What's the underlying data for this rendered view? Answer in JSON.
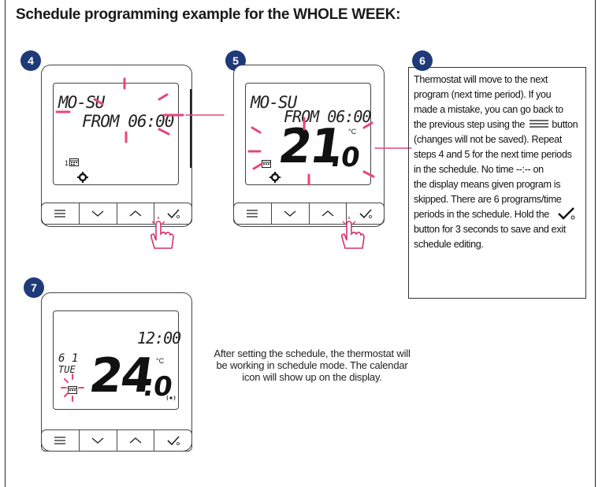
{
  "title": "Schedule programming example for the WHOLE WEEK:",
  "steps": [
    {
      "number": "4",
      "lcd_days": "MO-SU",
      "lcd_from": "FROM 06:00"
    },
    {
      "number": "5",
      "lcd_days": "MO-SU",
      "lcd_from": "FROM 06:00",
      "temp_int": "21",
      "temp_dec": ".0",
      "unit": "°C"
    },
    {
      "number": "6",
      "text": "Thermostat will move to the next program (next time period). If you made a mistake, you can go back to the previous step using the ☰ button (changes will not be saved). Repeat steps 4 and 5 for the next time periods in the schedule. No time --:-- on the display means given program is skipped. There are 6 programs/time periods in the schedule. Hold the ✔ button for 3 seconds to save and exit schedule editing."
    },
    {
      "number": "7",
      "lcd_time": "12:00",
      "lcd_day_num": "6 1",
      "lcd_day": "TUE",
      "temp_int": "24",
      "temp_dec": ".0",
      "unit": "°C",
      "caption": "After setting the schedule, the thermostat will be working in schedule mode. The calendar icon will show up on the display."
    }
  ],
  "step6_lines": [
    "Thermostat will move to the next",
    "program (next time period). If you",
    "made a mistake, you can go back to",
    "the previous step using the",
    "button",
    "(changes will not be saved). Repeat",
    "steps 4 and 5 for the next time periods",
    "in the schedule. No time --:-- on",
    "the display means given program is",
    "skipped. There are 6 programs/time",
    "periods in the schedule. Hold  the",
    "button for 3 seconds to save and exit",
    "schedule editing."
  ],
  "icons": [
    "menu-icon",
    "chevron-down-icon",
    "chevron-up-icon",
    "check-power-icon",
    "hand-pointer-icon",
    "gear-icon",
    "calendar-icon",
    "signal-icon"
  ],
  "colors": {
    "badge": "#1f3a78",
    "blink": "#e8457a",
    "outline": "#444444"
  }
}
